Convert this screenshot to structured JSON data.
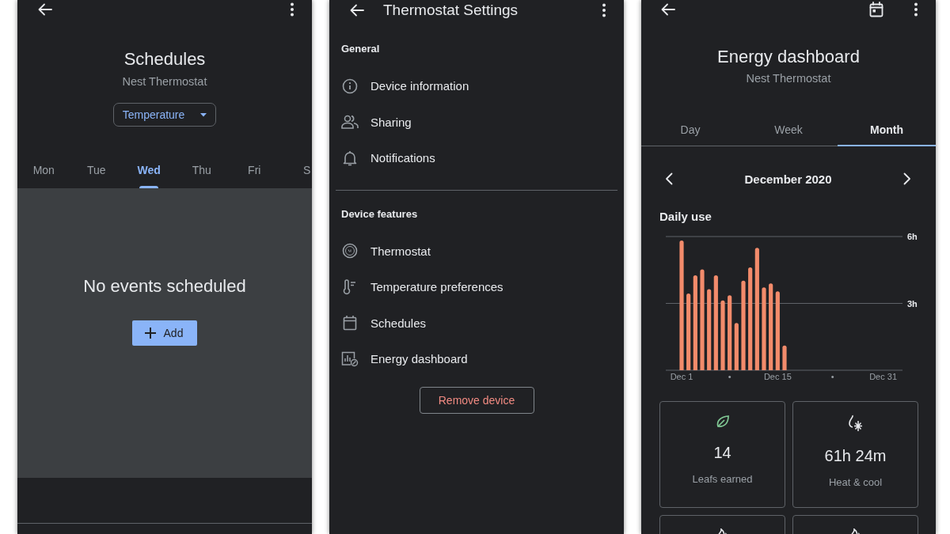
{
  "schedules_screen": {
    "title": "Schedules",
    "subtitle": "Nest Thermostat",
    "mode_dropdown": {
      "value": "Temperature"
    },
    "day_tabs": [
      {
        "label": "Mon",
        "selected": false
      },
      {
        "label": "Tue",
        "selected": false
      },
      {
        "label": "Wed",
        "selected": true
      },
      {
        "label": "Thu",
        "selected": false
      },
      {
        "label": "Fri",
        "selected": false
      },
      {
        "label": "S",
        "selected": false
      }
    ],
    "empty_message": "No events scheduled",
    "add_button": "Add"
  },
  "settings_screen": {
    "title": "Thermostat Settings",
    "sections": [
      {
        "heading": "General",
        "items": [
          {
            "kind": "info",
            "label": "Device information"
          },
          {
            "kind": "people",
            "label": "Sharing"
          },
          {
            "kind": "bell",
            "label": "Notifications"
          }
        ]
      },
      {
        "heading": "Device features",
        "items": [
          {
            "kind": "dial",
            "label": "Thermostat"
          },
          {
            "kind": "thermometer",
            "label": "Temperature preferences"
          },
          {
            "kind": "calendar",
            "label": "Schedules"
          },
          {
            "kind": "energy",
            "label": "Energy dashboard"
          }
        ]
      }
    ],
    "remove_button": "Remove device"
  },
  "energy_screen": {
    "title": "Energy dashboard",
    "subtitle": "Nest Thermostat",
    "tabs": [
      {
        "label": "Day",
        "selected": false
      },
      {
        "label": "Week",
        "selected": false
      },
      {
        "label": "Month",
        "selected": true
      }
    ],
    "period": "December 2020",
    "chart_data": {
      "type": "bar",
      "title": "Daily use",
      "categories": [
        "Dec 1",
        null,
        null,
        null,
        null,
        null,
        null,
        "•",
        null,
        null,
        null,
        null,
        null,
        null,
        "Dec 15",
        null,
        null,
        null,
        null,
        null,
        null,
        null,
        "•",
        null,
        null,
        null,
        null,
        null,
        null,
        null,
        "Dec 31"
      ],
      "values": [
        5.82,
        3.44,
        4.26,
        4.53,
        3.64,
        4.26,
        3.13,
        3.36,
        2.12,
        4.02,
        4.62,
        5.49,
        3.72,
        3.9,
        3.54,
        1.11,
        null,
        null,
        null,
        null,
        null,
        null,
        null,
        null,
        null,
        null,
        null,
        null,
        null,
        null,
        null
      ],
      "color": "#f28b6b",
      "ylim": [
        0,
        6
      ],
      "yticks": [
        {
          "value": 3,
          "label": "3h"
        },
        {
          "value": 6,
          "label": "6h"
        }
      ]
    },
    "stat_cards": [
      {
        "kind": "leaf",
        "value": "14",
        "label": "Leafs earned"
      },
      {
        "kind": "heat-cool",
        "value": "61h 24m",
        "label": "Heat & cool"
      },
      {
        "kind": "heat"
      },
      {
        "kind": "heat"
      }
    ]
  }
}
